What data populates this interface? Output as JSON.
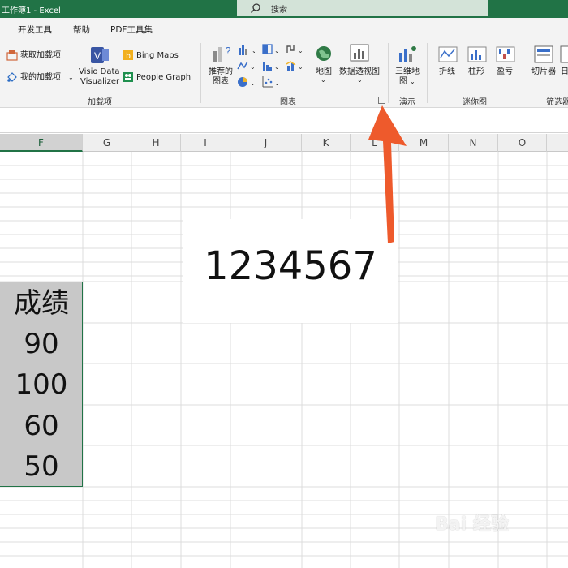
{
  "window": {
    "title": "工作簿1  -  Excel"
  },
  "search": {
    "label": "搜索"
  },
  "tabs": [
    "开发工具",
    "帮助",
    "PDF工具集"
  ],
  "ribbon": {
    "addins": {
      "get_addins": "获取加载项",
      "my_addins": "我的加载项",
      "visio_line1": "Visio Data",
      "visio_line2": "Visualizer",
      "bing_maps": "Bing Maps",
      "people_graph": "People Graph",
      "group_label": "加载项"
    },
    "charts": {
      "recommended_line1": "推荐的",
      "recommended_line2": "图表",
      "maps": "地图",
      "pivot_chart": "数据透视图",
      "group_label": "图表"
    },
    "tours": {
      "map3d_line1": "三维地",
      "map3d_line2": "图",
      "group_label": "演示"
    },
    "sparklines": {
      "line": "折线",
      "column": "柱形",
      "winloss": "盈亏",
      "group_label": "迷你图"
    },
    "filters": {
      "slicer": "切片器",
      "timeline": "日",
      "group_label": "筛选器"
    }
  },
  "columns": [
    "F",
    "G",
    "H",
    "I",
    "J",
    "K",
    "L",
    "M",
    "N",
    "O"
  ],
  "cells": {
    "header": "成绩",
    "values": [
      "90",
      "100",
      "60",
      "50"
    ]
  },
  "overlay_text": "1234567",
  "watermark": "Bai 经验",
  "colors": {
    "accent": "#217346",
    "arrow": "#ee5a2c"
  }
}
